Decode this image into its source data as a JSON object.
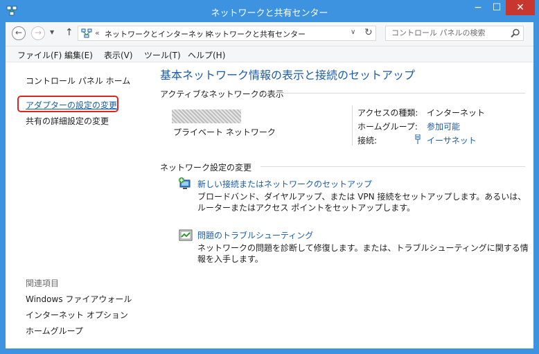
{
  "window": {
    "title": "ネットワークと共有センター",
    "controls": {
      "minimize": "−",
      "maximize": "☐",
      "close": "✕"
    }
  },
  "colors": {
    "frame": "#3d93e0",
    "link": "#1a5ca8",
    "close": "#c7372f",
    "highlight": "#e0231f"
  },
  "address": {
    "back": "←",
    "forward": "→",
    "recent": "▼",
    "up": "↑",
    "sep1": "«",
    "crumb1": "ネットワークとインターネット",
    "sep2": "›",
    "crumb2": "ネットワークと共有センター",
    "dropdown": "∨",
    "refresh": "↻"
  },
  "search": {
    "placeholder": "コントロール パネルの検索"
  },
  "menu": {
    "file": "ファイル(F)",
    "edit": "編集(E)",
    "view": "表示(V)",
    "tools": "ツール(T)",
    "help": "ヘルプ(H)"
  },
  "left": {
    "home": "コントロール パネル ホーム",
    "adapter": "アダプターの設定の変更",
    "sharing": "共有の詳細設定の変更",
    "related_title": "関連項目",
    "related": [
      "Windows ファイアウォール",
      "インターネット オプション",
      "ホームグループ"
    ]
  },
  "main": {
    "heading": "基本ネットワーク情報の表示と接続のセットアップ",
    "active_title": "アクティブなネットワークの表示",
    "network_name": "プライベート ネットワーク",
    "access_key": "アクセスの種類:",
    "access_val": "インターネット",
    "homegroup_key": "ホームグループ:",
    "homegroup_val": "参加可能",
    "conn_key": "接続:",
    "conn_val": "イーサネット",
    "change_title": "ネットワーク設定の変更",
    "task1_link": "新しい接続またはネットワークのセットアップ",
    "task1_desc": "ブロードバンド、ダイヤルアップ、または VPN 接続をセットアップします。あるいは、ルーターまたはアクセス ポイントをセットアップします。",
    "task2_link": "問題のトラブルシューティング",
    "task2_desc": "ネットワークの問題を診断して修復します。または、トラブルシューティングに関する情報を入手します。"
  }
}
